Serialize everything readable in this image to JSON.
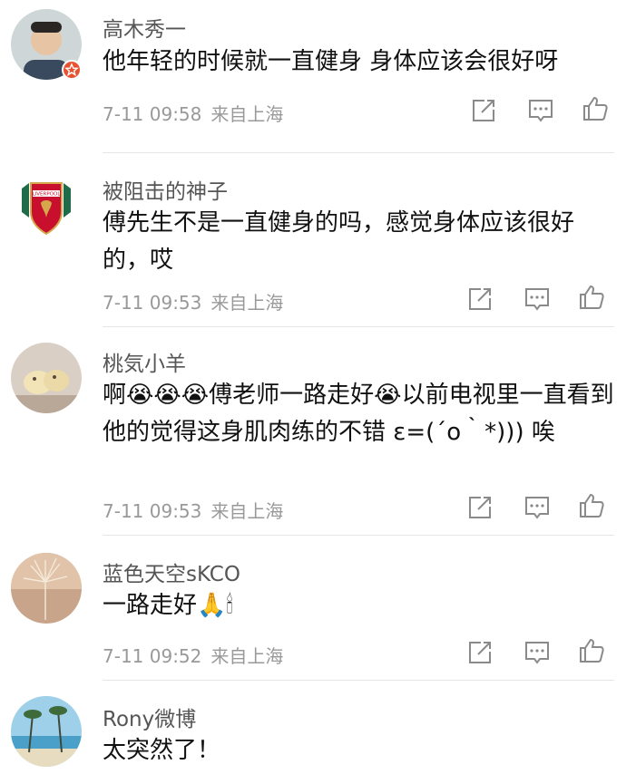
{
  "comments": [
    {
      "name": "高木秀一",
      "content": "他年轻的时候就一直健身 身体应该会很好呀",
      "date": "7-11 09:58",
      "location": "来自上海"
    },
    {
      "name": "被阻击的神子",
      "content": "傅先生不是一直健身的吗，感觉身体应该很好的，哎",
      "date": "7-11 09:53",
      "location": "来自上海"
    },
    {
      "name": "桃気小羊",
      "content_parts": [
        "啊",
        "😭😭😭",
        "傅老师一路走好",
        "😭",
        "以前电视里一直看到他的觉得这身肌肉练的不错 ε=(´ο｀*))) 唉"
      ],
      "date": "7-11 09:53",
      "location": "来自上海"
    },
    {
      "name": "蓝色天空sKCO",
      "content_parts": [
        "一路走好",
        "🙏🕯"
      ],
      "date": "7-11 09:52",
      "location": "来自上海"
    },
    {
      "name": "Rony微博",
      "content": "太突然了！"
    }
  ],
  "icons": {
    "share": "share-icon",
    "comment": "comment-icon",
    "like": "thumbs-up-icon"
  },
  "colors": {
    "name": "#555555",
    "meta": "#999999",
    "badge": "#e8502f"
  }
}
